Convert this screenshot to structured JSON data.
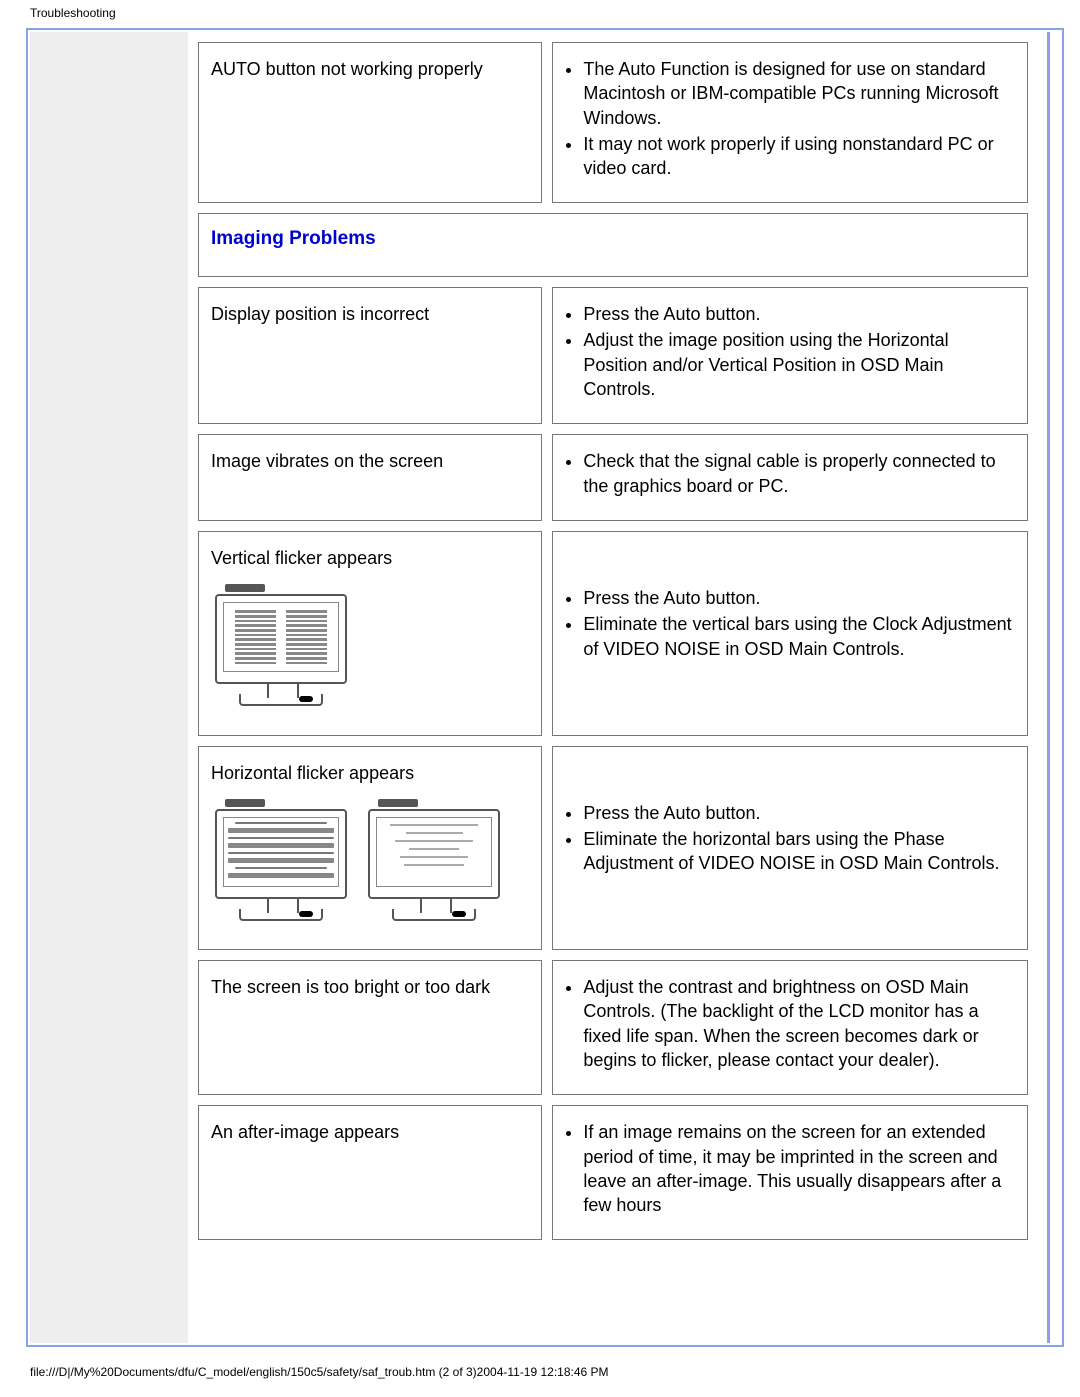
{
  "header": {
    "title": "Troubleshooting"
  },
  "footer": {
    "path": "file:///D|/My%20Documents/dfu/C_model/english/150c5/safety/saf_troub.htm (2 of 3)2004-11-19 12:18:46 PM"
  },
  "section": {
    "imaging_heading": "Imaging Problems"
  },
  "rows": {
    "auto": {
      "label": "AUTO button not working properly",
      "li1": "The Auto Function is designed for use on standard Macintosh or IBM-compatible PCs running Microsoft Windows.",
      "li2": "It may not work properly if using nonstandard PC or video card."
    },
    "position": {
      "label": "Display position is incorrect",
      "li1": "Press the Auto button.",
      "li2": "Adjust the image position using the Horizontal Position and/or Vertical Position in OSD Main Controls."
    },
    "vibrate": {
      "label": "Image vibrates on the screen",
      "li1": "Check that the signal cable is properly connected to the graphics board or PC."
    },
    "vflicker": {
      "label": "Vertical flicker appears",
      "li1": "Press the Auto button.",
      "li2": "Eliminate the vertical bars using the Clock Adjustment of VIDEO NOISE in OSD Main Controls."
    },
    "hflicker": {
      "label": "Horizontal flicker appears",
      "li1": "Press the Auto button.",
      "li2": "Eliminate the horizontal bars using the Phase Adjustment of VIDEO NOISE in OSD Main Controls."
    },
    "bright": {
      "label": "The screen is too bright or too dark",
      "li1": "Adjust the contrast and brightness on OSD Main Controls. (The backlight of the LCD monitor has a fixed life span. When the screen becomes dark or begins to flicker, please contact your dealer)."
    },
    "after": {
      "label": "An after-image appears",
      "li1": "If an image remains on the screen for an extended period of time, it may be imprinted in the screen and leave an after-image. This usually disappears after a few hours"
    }
  }
}
